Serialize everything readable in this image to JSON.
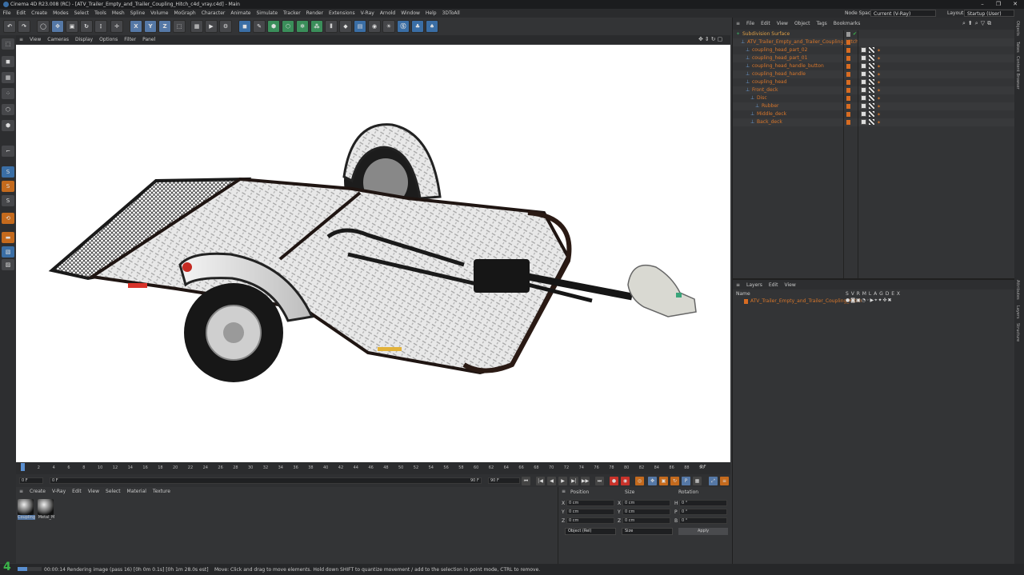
{
  "app": {
    "title": "Cinema 4D R23.008 (RC) - [ATV_Trailer_Empty_and_Trailer_Coupling_Hitch_c4d_vray.c4d] - Main",
    "window_controls": [
      "–",
      "❐",
      "✕"
    ]
  },
  "menubar": {
    "items": [
      "File",
      "Edit",
      "Create",
      "Modes",
      "Select",
      "Tools",
      "Mesh",
      "Spline",
      "Volume",
      "MoGraph",
      "Character",
      "Animate",
      "Simulate",
      "Tracker",
      "Render",
      "Extensions",
      "V-Ray",
      "Arnold",
      "Window",
      "Help",
      "3DToAll"
    ],
    "node_space_label": "Node Space:",
    "node_space_value": "Current (V-Ray)",
    "layout_label": "Layout:",
    "layout_value": "Startup (User)"
  },
  "toolbar": {
    "axis_x": "X",
    "axis_y": "Y",
    "axis_z": "Z"
  },
  "viewport": {
    "menu": [
      "View",
      "Cameras",
      "Display",
      "Options",
      "Filter",
      "Panel"
    ]
  },
  "timeline": {
    "ticks": [
      "0",
      "2",
      "4",
      "6",
      "8",
      "10",
      "12",
      "14",
      "16",
      "18",
      "20",
      "22",
      "24",
      "26",
      "28",
      "30",
      "32",
      "34",
      "36",
      "38",
      "40",
      "42",
      "44",
      "46",
      "48",
      "50",
      "52",
      "54",
      "56",
      "58",
      "60",
      "62",
      "64",
      "66",
      "68",
      "70",
      "72",
      "74",
      "76",
      "78",
      "80",
      "82",
      "84",
      "86",
      "88",
      "90"
    ],
    "frame_end_label": "0 F",
    "start": "0 F",
    "current": "0 F",
    "end_a": "90 F",
    "end_b": "90 F"
  },
  "material_manager": {
    "menu": [
      "Create",
      "V-Ray",
      "Edit",
      "View",
      "Select",
      "Material",
      "Texture"
    ],
    "materials": [
      {
        "name": "Coupling"
      },
      {
        "name": "Metal_M"
      }
    ]
  },
  "coordinates": {
    "headers": [
      "Position",
      "Size",
      "Rotation"
    ],
    "rows": [
      {
        "axis": "X",
        "pos": "0 cm",
        "saxis": "X",
        "size": "0 cm",
        "raxis": "H",
        "rot": "0 °"
      },
      {
        "axis": "Y",
        "pos": "0 cm",
        "saxis": "Y",
        "size": "0 cm",
        "raxis": "P",
        "rot": "0 °"
      },
      {
        "axis": "Z",
        "pos": "0 cm",
        "saxis": "Z",
        "size": "0 cm",
        "raxis": "B",
        "rot": "0 °"
      }
    ],
    "mode": "Object (Rel)",
    "size_mode": "Size",
    "apply": "Apply"
  },
  "object_manager": {
    "menu": [
      "File",
      "Edit",
      "View",
      "Object",
      "Tags",
      "Bookmarks"
    ],
    "objects": [
      {
        "name": "Subdivision Surface",
        "depth": 0
      },
      {
        "name": "ATV_Trailer_Empty_and_Trailer_Coupling_Hitch",
        "depth": 1
      },
      {
        "name": "coupling_head_part_02",
        "depth": 2
      },
      {
        "name": "coupling_head_part_01",
        "depth": 2
      },
      {
        "name": "coupling_head_handle_button",
        "depth": 2
      },
      {
        "name": "coupling_head_handle",
        "depth": 2
      },
      {
        "name": "coupling_head",
        "depth": 2
      },
      {
        "name": "Front_deck",
        "depth": 2
      },
      {
        "name": "Disc",
        "depth": 3
      },
      {
        "name": "Rubber",
        "depth": 4
      },
      {
        "name": "Middle_deck",
        "depth": 3
      },
      {
        "name": "Back_deck",
        "depth": 3
      }
    ]
  },
  "layer_manager": {
    "menu": [
      "Layers",
      "Edit",
      "View"
    ],
    "name_header": "Name",
    "columns": "S V R M L A G D E X",
    "layer": "ATV_Trailer_Empty_and_Trailer_Coupling_Hitch"
  },
  "right_tabs": [
    "Objects",
    "Takes",
    "Content Browser",
    "Attributes",
    "Layers",
    "Structure"
  ],
  "status": {
    "logo": "4",
    "render": "00:00:14 Rendering image (pass 16) [0h 0m 0.1s] [0h 1m 28.0s est]",
    "hint": "Move: Click and drag to move elements. Hold down SHIFT to quantize movement / add to the selection in point mode, CTRL to remove."
  },
  "colors": {
    "accent": "#d9772b",
    "selection": "#5578a6",
    "background": "#333436"
  }
}
